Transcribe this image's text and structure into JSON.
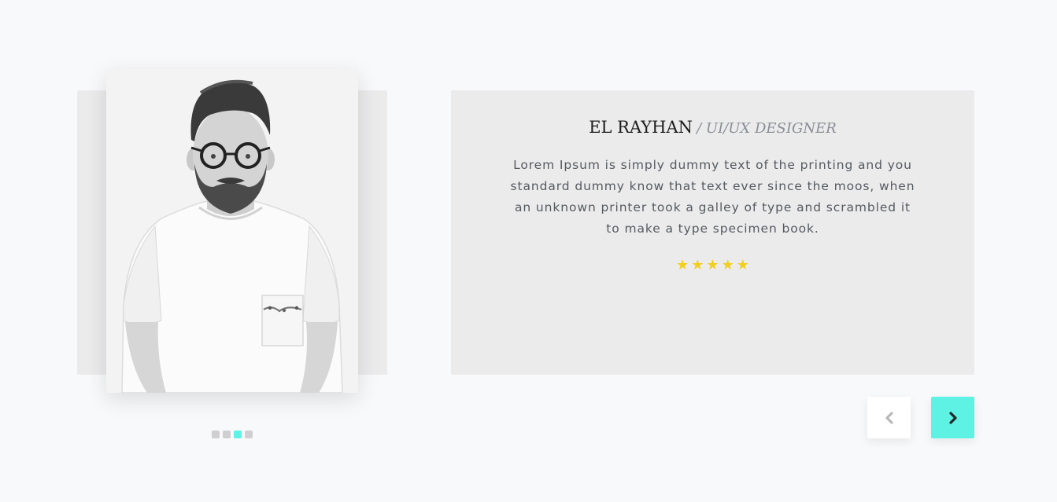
{
  "testimonial": {
    "name": "EL RAYHAN",
    "role": "/ UI/UX DESIGNER",
    "quote": "Lorem Ipsum is simply dummy text of the printing and you standard dummy know that text ever since the moos, when an unknown printer took a galley of type and scrambled it to make a type specimen book.",
    "rating": 5,
    "stars": [
      "★",
      "★",
      "★",
      "★",
      "★"
    ]
  },
  "pagination": {
    "total": 4,
    "active_index": 2
  },
  "navigation": {
    "prev_icon": "chevron-left-icon",
    "next_icon": "chevron-right-icon"
  },
  "colors": {
    "page_background": "#f8f9fb",
    "card_background": "#ebebec",
    "accent": "#5df2e4",
    "star": "#f2cf1e",
    "role_text": "#8a8f95"
  }
}
